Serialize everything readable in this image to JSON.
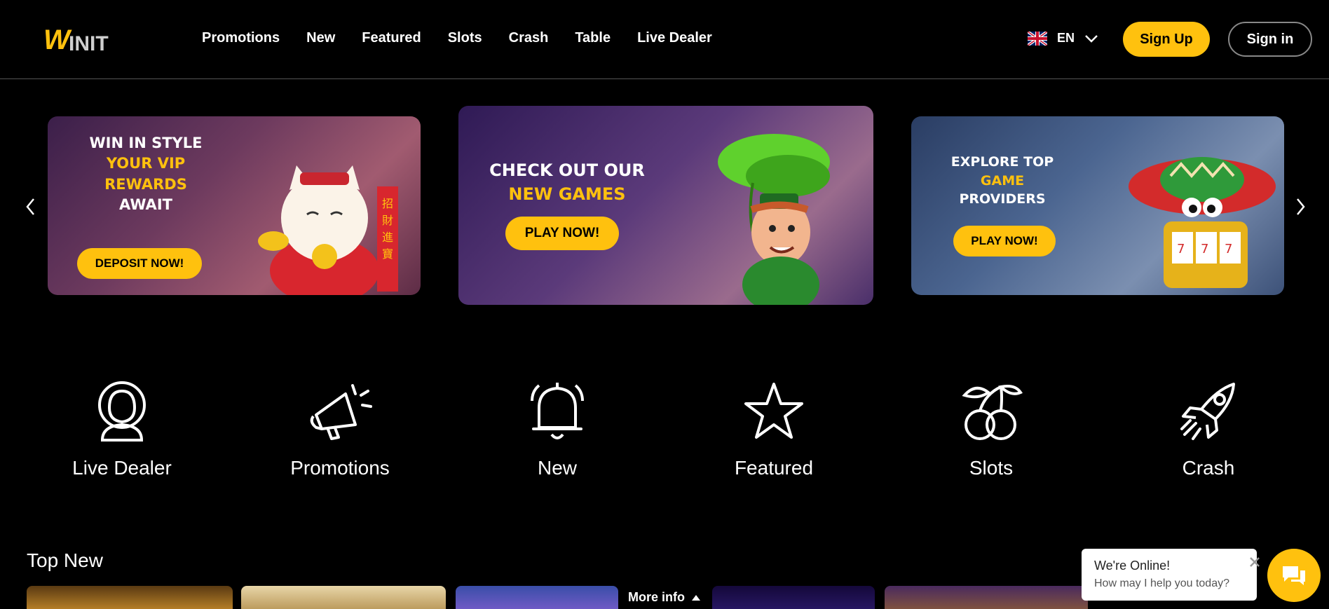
{
  "header": {
    "logo_text": "WINIT",
    "nav": [
      "Promotions",
      "New",
      "Featured",
      "Slots",
      "Crash",
      "Table",
      "Live Dealer"
    ],
    "language": "EN",
    "signup_label": "Sign Up",
    "signin_label": "Sign in"
  },
  "banners": [
    {
      "lines": [
        {
          "text": "WIN IN STYLE",
          "style": "w"
        },
        {
          "text": "YOUR VIP",
          "style": "y"
        },
        {
          "text": "REWARDS",
          "style": "y"
        },
        {
          "text": "AWAIT",
          "style": "w"
        }
      ],
      "button": "DEPOSIT NOW!"
    },
    {
      "lines": [
        {
          "text": "CHECK OUT OUR",
          "style": "w"
        },
        {
          "text": "NEW GAMES",
          "style": "y"
        }
      ],
      "button": "PLAY NOW!"
    },
    {
      "lines": [
        {
          "text": "EXPLORE TOP",
          "style": "w"
        },
        {
          "text": "GAME",
          "style": "y"
        },
        {
          "text": "PROVIDERS",
          "style": "w"
        }
      ],
      "button": "PLAY NOW!"
    }
  ],
  "categories": [
    {
      "label": "Live Dealer",
      "icon": "live-dealer-icon"
    },
    {
      "label": "Promotions",
      "icon": "megaphone-icon"
    },
    {
      "label": "New",
      "icon": "bell-icon"
    },
    {
      "label": "Featured",
      "icon": "star-icon"
    },
    {
      "label": "Slots",
      "icon": "cherries-icon"
    },
    {
      "label": "Crash",
      "icon": "rocket-icon"
    }
  ],
  "top_new": {
    "title": "Top New",
    "more_info": "More info"
  },
  "chat": {
    "title": "We're Online!",
    "subtitle": "How may I help you today?"
  },
  "colors": {
    "accent": "#ffc10e",
    "background": "#000000"
  }
}
